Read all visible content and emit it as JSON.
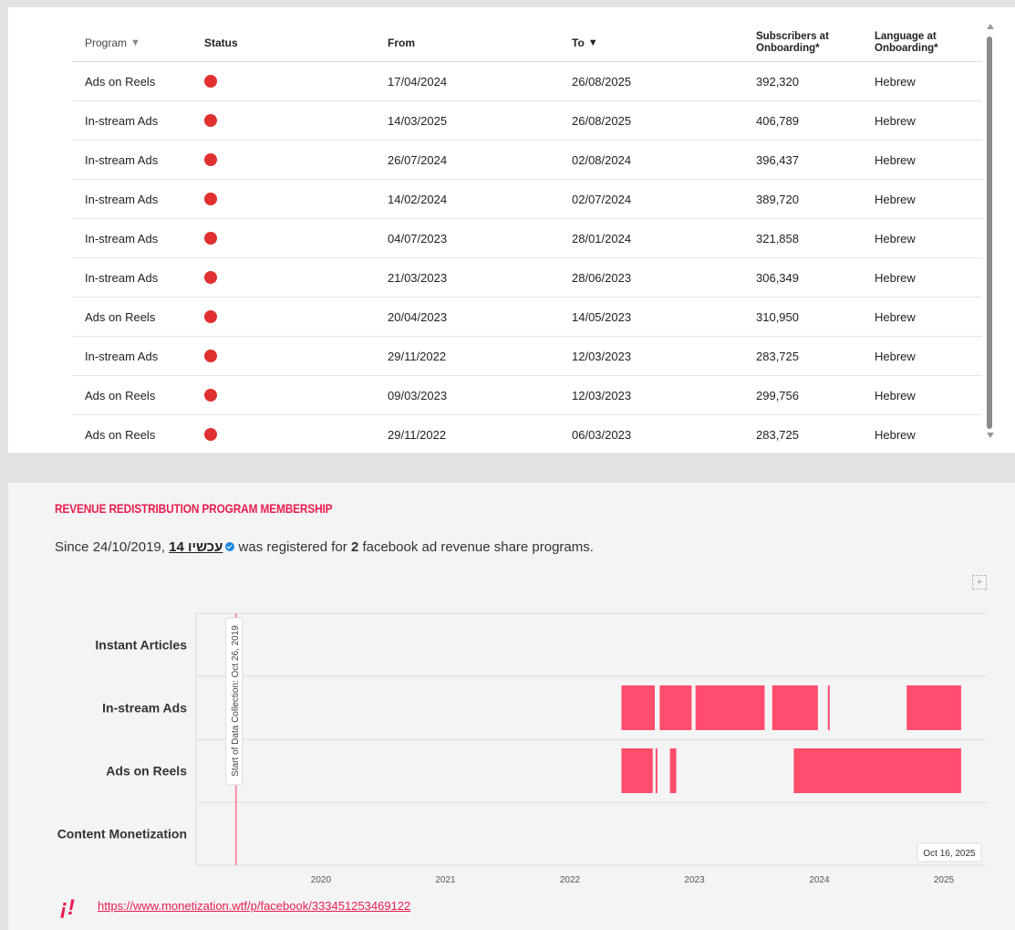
{
  "table": {
    "columns": {
      "program": "Program",
      "status": "Status",
      "from": "From",
      "to": "To",
      "subscribers": "Subscribers at Onboarding*",
      "language": "Language at Onboarding*"
    },
    "sort_icon": "triangle-down-icon",
    "status_color": "#e03030",
    "rows": [
      {
        "program": "Ads on Reels",
        "from": "17/04/2024",
        "to": "26/08/2025",
        "subscribers": "392,320",
        "language": "Hebrew"
      },
      {
        "program": "In-stream Ads",
        "from": "14/03/2025",
        "to": "26/08/2025",
        "subscribers": "406,789",
        "language": "Hebrew"
      },
      {
        "program": "In-stream Ads",
        "from": "26/07/2024",
        "to": "02/08/2024",
        "subscribers": "396,437",
        "language": "Hebrew"
      },
      {
        "program": "In-stream Ads",
        "from": "14/02/2024",
        "to": "02/07/2024",
        "subscribers": "389,720",
        "language": "Hebrew"
      },
      {
        "program": "In-stream Ads",
        "from": "04/07/2023",
        "to": "28/01/2024",
        "subscribers": "321,858",
        "language": "Hebrew"
      },
      {
        "program": "In-stream Ads",
        "from": "21/03/2023",
        "to": "28/06/2023",
        "subscribers": "306,349",
        "language": "Hebrew"
      },
      {
        "program": "Ads on Reels",
        "from": "20/04/2023",
        "to": "14/05/2023",
        "subscribers": "310,950",
        "language": "Hebrew"
      },
      {
        "program": "In-stream Ads",
        "from": "29/11/2022",
        "to": "12/03/2023",
        "subscribers": "283,725",
        "language": "Hebrew"
      },
      {
        "program": "Ads on Reels",
        "from": "09/03/2023",
        "to": "12/03/2023",
        "subscribers": "299,756",
        "language": "Hebrew"
      },
      {
        "program": "Ads on Reels",
        "from": "29/11/2022",
        "to": "06/03/2023",
        "subscribers": "283,725",
        "language": "Hebrew"
      }
    ]
  },
  "membership": {
    "title": "REVENUE REDISTRIBUTION PROGRAM MEMBERSHIP",
    "summary_prefix": "Since 24/10/2019, ",
    "page_name": "14 עכשיו",
    "summary_mid": " was registered for ",
    "program_count": "2",
    "summary_suffix": " facebook ad revenue share programs.",
    "expand_icon": "expand-icon",
    "link": "https://www.monetization.wtf/p/facebook/333451253469122",
    "logo_text": "¡!"
  },
  "chart_data": {
    "type": "timeline",
    "categories": [
      "Instant Articles",
      "In-stream Ads",
      "Ads on Reels",
      "Content Monetization"
    ],
    "x_ticks": [
      "2020",
      "2021",
      "2022",
      "2023",
      "2024",
      "2025"
    ],
    "x_range": [
      "2019-07-01",
      "2025-11-01"
    ],
    "bar_color": "#ff4d6d",
    "marker": {
      "date": "2019-10-26",
      "label": "Start of Data Collection: Oct 26, 2019",
      "color": "#f48fa4"
    },
    "end_label": "Oct 16, 2025",
    "series": [
      {
        "category": "In-stream Ads",
        "bars": [
          [
            "2022-11-29",
            "2023-03-12"
          ],
          [
            "2023-03-21",
            "2023-06-28"
          ],
          [
            "2023-07-04",
            "2024-01-28"
          ],
          [
            "2024-02-14",
            "2024-07-02"
          ],
          [
            "2024-07-26",
            "2024-08-02"
          ],
          [
            "2025-03-14",
            "2025-08-26"
          ]
        ]
      },
      {
        "category": "Ads on Reels",
        "bars": [
          [
            "2022-11-29",
            "2023-03-06"
          ],
          [
            "2023-03-09",
            "2023-03-12"
          ],
          [
            "2023-04-20",
            "2023-05-14"
          ],
          [
            "2024-04-17",
            "2025-08-26"
          ]
        ]
      }
    ]
  }
}
